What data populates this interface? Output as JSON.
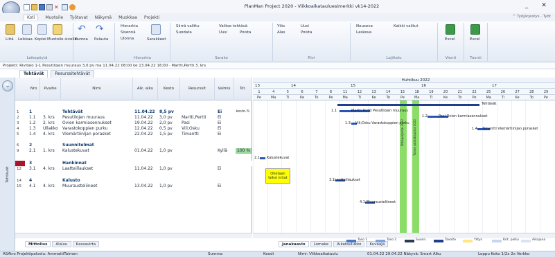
{
  "app": {
    "title": "PlanMan Project 2020 - Viikkoaikatauluesimerkki vk14-2022",
    "min": "_",
    "close": "✕"
  },
  "menu_tabs": [
    "Koti",
    "Muotoile",
    "Työtavat",
    "Näkymä",
    "Muokkaa",
    "Projekti"
  ],
  "menu_right": "^ Työjärjestys · Työt",
  "ribbon": {
    "lite": "Liitä",
    "leikkaa": "Leikkaa",
    "kopioi": "Kopioi",
    "muotoile_siveltimella": "Muotoile sivellin",
    "kumoa": "Kumoa",
    "palauta": "Palauta",
    "hierarkia": "Hierarkia",
    "sisenna": "Sisennä",
    "ulonna": "Ulonna",
    "siirra": "Siirrä valittu",
    "uusi_tehtava": "Valitse tehtävä",
    "sarakkeet": "Sarakkeet",
    "suodata": "Suodata",
    "uusi": "Uusi",
    "poista": "Poista",
    "ylos": "Ylös",
    "alas": "Alas",
    "nouseva": "Nouseva",
    "laskeva": "Laskeva",
    "kaikki_valitut": "Kaikki valitut",
    "excel": "Excel",
    "group_leikepoyta": "Leikepöytä",
    "group_hierarkia": "Hierarkia",
    "group_sarake": "Sarake",
    "group_rivi": "Rivi",
    "group_lajittelu": "Lajittelu",
    "group_vienti": "Vienti",
    "group_tuonti": "Tuonti"
  },
  "project_line": "Projekti: Rivitalo 1-1 Pesutilojen muuraus 3,0 pv ma 11.04.22 08:00 ke 13.04.22 16:00 · Martti,Pertti 3. krs",
  "view_tabs": {
    "a": "Tehtävät",
    "b": "Resurssitehtävät"
  },
  "left_label": "Tehtävät",
  "columns": {
    "num": "Nro",
    "phase": "Pvaihe",
    "name": "Nimi",
    "start": "Alk. alku",
    "duration": "Kesto",
    "resources": "Resurssit",
    "done": "Valmis",
    "total": "Tot. kesto-%"
  },
  "rows": [
    {
      "n": "1",
      "id": "1",
      "phase": "",
      "name": "Tehtävät",
      "start": "11.04.22",
      "dur": "8,5 pv",
      "res": "",
      "done": "Ei",
      "summary": true
    },
    {
      "n": "2",
      "id": "1.1",
      "phase": "3. krs",
      "name": "Pesutilojen muuraus",
      "start": "11.04.22",
      "dur": "3,0 pv",
      "res": "Martti,Pertti",
      "done": "Ei",
      "summary": false
    },
    {
      "n": "3",
      "id": "1.2",
      "phase": "2. krs",
      "name": "Ovien karmiasennukset",
      "start": "19.04.22",
      "dur": "2,0 pv",
      "res": "Pasi",
      "done": "Ei",
      "summary": false
    },
    {
      "n": "4",
      "id": "1.3",
      "phase": "Ullakko",
      "name": "Varastokoppien purku",
      "start": "12.04.22",
      "dur": "0,5 pv",
      "res": "Vili;Osku",
      "done": "Ei",
      "summary": false
    },
    {
      "n": "5",
      "id": "1.4",
      "phase": "4. krs",
      "name": "Vlemärtiinljan porasket",
      "start": "22.04.22",
      "dur": "1,5 pv",
      "res": "Timantti",
      "done": "Ei",
      "summary": false
    },
    {
      "n": "6",
      "id": "2",
      "phase": "",
      "name": "Suunnitelmat",
      "start": "",
      "dur": "",
      "res": "",
      "done": "",
      "summary": true
    },
    {
      "n": "9",
      "id": "2.1",
      "phase": "1. krs",
      "name": "Kalustekuvat",
      "start": "01.04.22",
      "dur": "1,0 pv",
      "res": "",
      "done": "Kyllä",
      "pct": "100 %",
      "summary": false
    },
    {
      "n": "11",
      "id": "3",
      "phase": "",
      "name": "Hankinnat",
      "start": "",
      "dur": "",
      "res": "",
      "done": "",
      "summary": true
    },
    {
      "n": "12",
      "id": "3.1",
      "phase": "4. krs",
      "name": "Laatteillaukset",
      "start": "11.04.22",
      "dur": "1,0 pv",
      "res": "",
      "done": "Ei",
      "summary": false
    },
    {
      "n": "14",
      "id": "4",
      "phase": "",
      "name": "Kalusto",
      "start": "",
      "dur": "",
      "res": "",
      "done": "",
      "summary": true
    },
    {
      "n": "15",
      "id": "4.1",
      "phase": "4. krs",
      "name": "Muurausteliineet",
      "start": "13.04.22",
      "dur": "1,0 pv",
      "res": "",
      "done": "Ei",
      "summary": false
    }
  ],
  "gantt": {
    "month": "Huhtikuu 2022",
    "weeks": [
      "13",
      "14",
      "15",
      "16",
      "17"
    ],
    "days": [
      "1",
      "4",
      "5",
      "6",
      "7",
      "8",
      "11",
      "12",
      "13",
      "14",
      "15",
      "18",
      "19",
      "20",
      "21",
      "22",
      "25",
      "26",
      "27",
      "28",
      "29"
    ],
    "weekdays": [
      "Pe",
      "Ma",
      "Ti",
      "Ke",
      "To",
      "Pe",
      "Ma",
      "Ti",
      "Ke",
      "To",
      "Pe",
      "Ma",
      "Ti",
      "Ke",
      "To",
      "Pe",
      "Ma",
      "Ti",
      "Ke",
      "To",
      "Pe"
    ],
    "holiday1": "Pitkäperjantai 2022",
    "holiday2": "Toinen pääsiäispäivä 2022",
    "labels": {
      "tehtavat": "Tehtävät",
      "pesu": "Martti,Pertti  Pesutilojen muuraus",
      "pesu_id": "1.1",
      "ovi": "Pasi   Ovien karmiasennukset",
      "ovi_id": "1.2",
      "varasto": "Vili;Osku  Varastokoppien purku",
      "varasto_id": "1.3",
      "vlem": "Timantti  Vlemärtiinljan porasket",
      "vlem_id": "1.4",
      "kaluste": "Kalustekuvat",
      "kaluste_id": "2.1",
      "note": "Ohetaan laiksi mitat",
      "laatta": "Laatteillaukset",
      "laatta_id": "3.1",
      "muur": "Muurausteliineet",
      "muur_id": "4.1"
    }
  },
  "bottom_tabs_left": [
    "Mittolius",
    "Alaluu",
    "Kassavirta"
  ],
  "bottom_tabs_right": [
    "Janakaavio",
    "Lomake",
    "Aikataulukko",
    "Kuvaaja"
  ],
  "legend": [
    "Taso 1",
    "Taso 2",
    "Suunn.",
    "Tavoite",
    "Ylitys",
    "Krit. polku",
    "Aikajana"
  ],
  "status": {
    "left": "ASAtro Projektipalvelu: AmmattiTaimen",
    "summa": "Summa",
    "koodi": "Koodi",
    "nimi": "Nimi: Viikkoaikataulu",
    "dates": "01.04.22  29.04.22  Näkyvä: Smart  Alku",
    "zoom": "Loppu  Koko  1/2x  2x  Verkko"
  },
  "colors": {
    "summary_bar": "#1f3f8a",
    "task_bar": "#2456b8",
    "holiday": "#7ed957",
    "note": "#ffff00",
    "done_pct": "#9ed7a0"
  }
}
